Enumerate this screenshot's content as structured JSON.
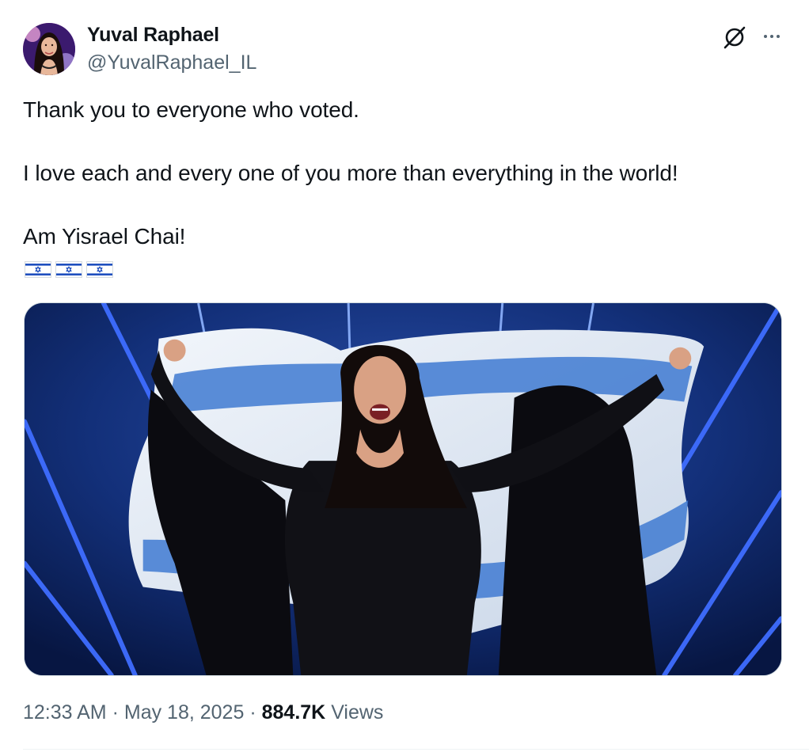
{
  "author": {
    "name": "Yuval Raphael",
    "handle": "@YuvalRaphael_IL"
  },
  "post": {
    "lines": [
      "Thank you to everyone who voted.",
      "I love each and every one of you more than everything in the world!",
      "Am Yisrael Chai!"
    ],
    "emoji": [
      "flag-israel",
      "flag-israel",
      "flag-israel"
    ]
  },
  "meta": {
    "time": "12:33 AM",
    "separator": "·",
    "date": "May 18, 2025",
    "views_count": "884.7K",
    "views_label": "Views"
  },
  "colors": {
    "text": "#0f1419",
    "secondary": "#536471",
    "flag_blue": "#1f4fbf",
    "stage_blue": "#1e40d8"
  }
}
